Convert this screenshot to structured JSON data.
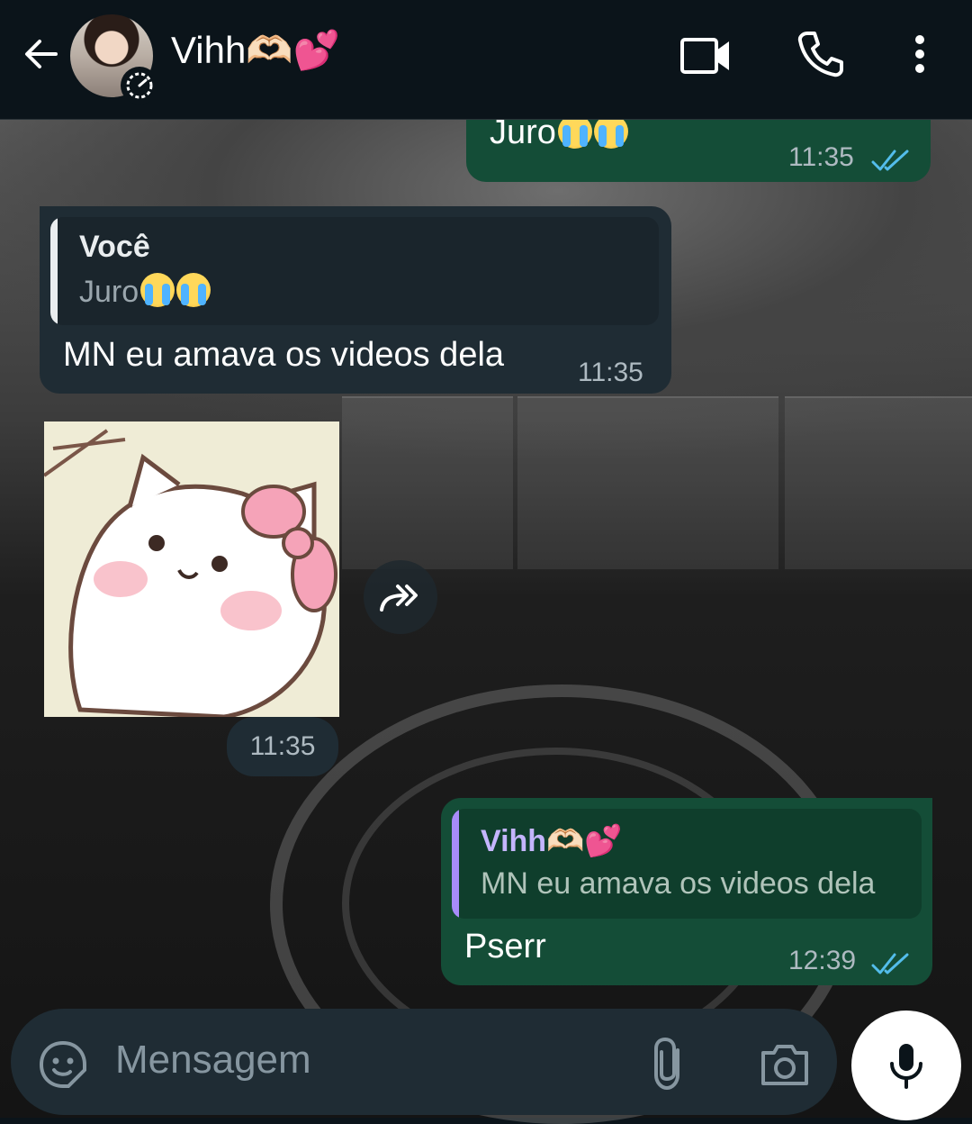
{
  "header": {
    "contact_name": "Vihh🫶🏻💕",
    "icons": [
      "back-arrow-icon",
      "status-timer-icon",
      "video-call-icon",
      "voice-call-icon",
      "more-options-icon"
    ]
  },
  "messages": [
    {
      "type": "outgoing",
      "text": "Juro😭😭",
      "time": "11:35",
      "status": "read"
    },
    {
      "type": "incoming",
      "quote_author": "Você",
      "quote_text": "Juro😭😭",
      "text": "MN eu amava os videos dela",
      "time": "11:35"
    },
    {
      "type": "incoming-sticker",
      "time": "11:35"
    },
    {
      "type": "outgoing",
      "quote_author": "Vihh🫶🏻💕",
      "quote_text": "MN eu amava os videos dela",
      "text": "Pserr",
      "time": "12:39",
      "status": "read"
    }
  ],
  "msg1": {
    "text_prefix": "Juro",
    "time": "11:35"
  },
  "msg2": {
    "quote_author": "Você",
    "quote_text_prefix": "Juro",
    "text": "MN eu amava os videos dela",
    "time": "11:35"
  },
  "msg3": {
    "time": "11:35"
  },
  "msg4": {
    "quote_author": "Vihh🫶🏻💕",
    "quote_text": "MN eu amava os videos dela",
    "text": "Pserr",
    "time": "12:39"
  },
  "composer": {
    "placeholder": "Mensagem"
  },
  "colors": {
    "header_bg": "#0b141a",
    "outgoing_bubble": "#144d37",
    "incoming_bubble": "#1f2c34",
    "read_tick": "#53bdeb",
    "quote_bar_incoming": "#e9edef",
    "quote_bar_outgoing": "#a78bfa"
  }
}
